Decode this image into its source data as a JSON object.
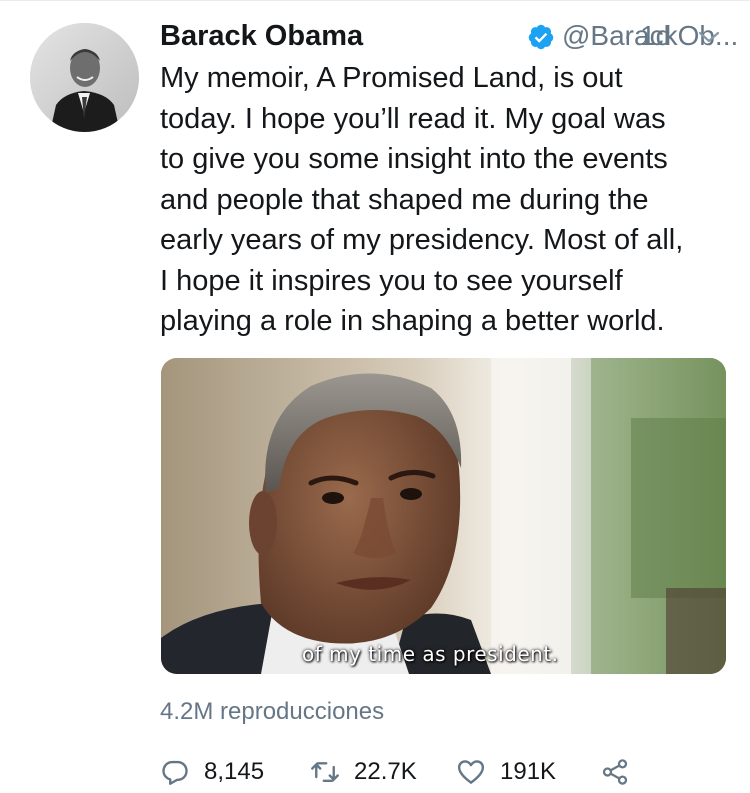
{
  "tweet": {
    "author_name": "Barack Obama",
    "handle": "@BarackOb...",
    "time_separator": "·",
    "time": "1d",
    "text_lines": [
      "My memoir, A Promised Land, is out",
      "today. I hope you’ll read it. My goal was",
      "to give you some insight into the events",
      "and people that shaped me during the",
      "early years of my presidency. Most of all,",
      "I hope it inspires you to see yourself",
      "playing a role in shaping a better world."
    ],
    "video_caption": "of my time as president.",
    "views": "4.2M reproducciones",
    "reply_count": "8,145",
    "retweet_count": "22.7K",
    "like_count": "191K"
  },
  "icons": {
    "verified": "verified-badge-icon",
    "chevron": "chevron-down-icon",
    "reply": "reply-icon",
    "retweet": "retweet-icon",
    "like": "heart-icon",
    "share": "share-icon"
  },
  "colors": {
    "text": "#14171a",
    "secondary": "#657786",
    "verified": "#1da1f2"
  }
}
